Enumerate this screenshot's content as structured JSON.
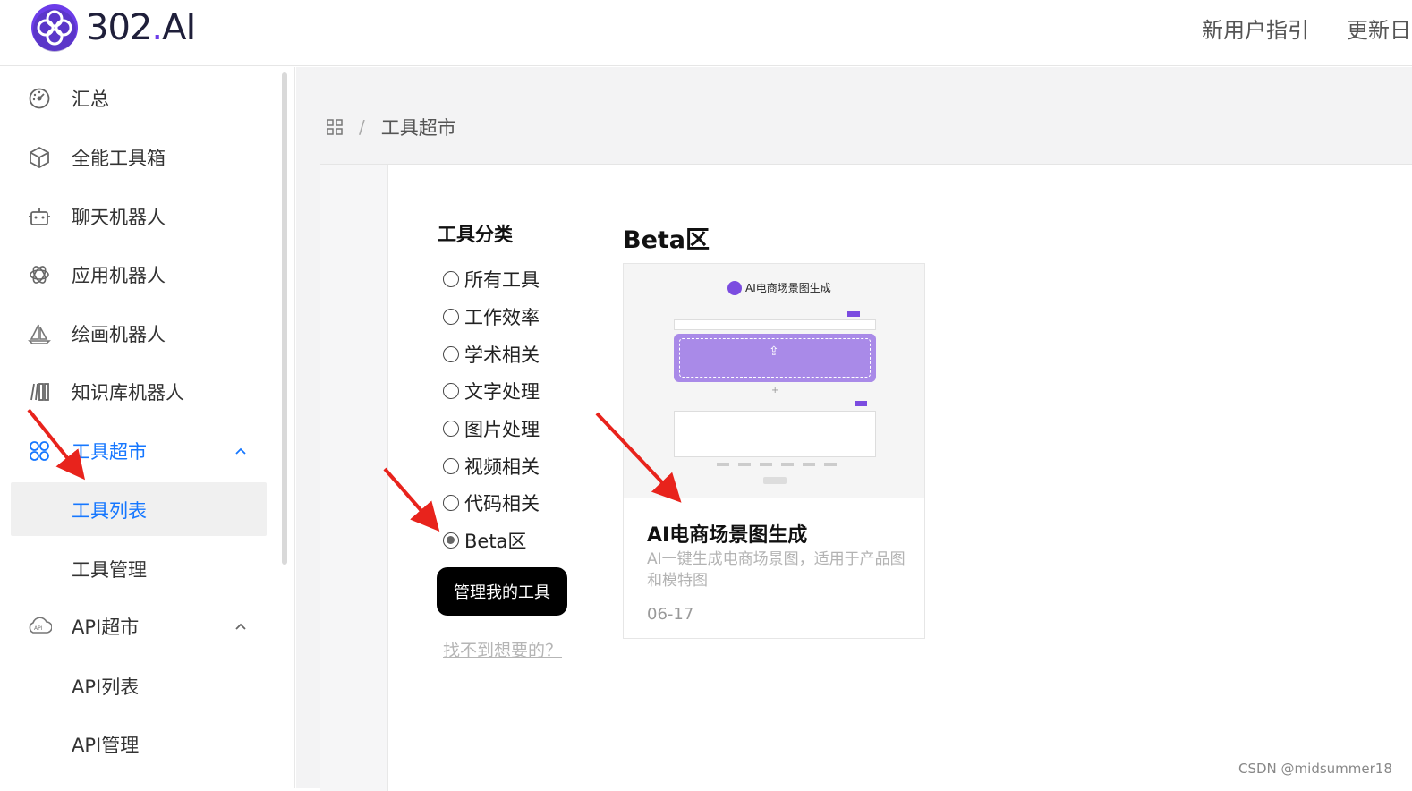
{
  "header": {
    "brand": "302",
    "brand_dot": ".",
    "brand_suffix": "AI",
    "nav": [
      "新用户指引",
      "更新日"
    ]
  },
  "sidebar": {
    "items": [
      {
        "label": "汇总",
        "icon": "dashboard-icon"
      },
      {
        "label": "全能工具箱",
        "icon": "cube-icon"
      },
      {
        "label": "聊天机器人",
        "icon": "robot-icon"
      },
      {
        "label": "应用机器人",
        "icon": "openai-icon"
      },
      {
        "label": "绘画机器人",
        "icon": "sailboat-icon"
      },
      {
        "label": "知识库机器人",
        "icon": "books-icon"
      },
      {
        "label": "工具超市",
        "icon": "grid-icon",
        "expanded": true
      },
      {
        "label": "API超市",
        "icon": "cloud-api-icon",
        "expanded": true
      }
    ],
    "tool_sub": [
      "工具列表",
      "工具管理"
    ],
    "api_sub": [
      "API列表",
      "API管理"
    ],
    "selected": "工具列表"
  },
  "breadcrumb": {
    "icon": "grid-icon",
    "separator": "/",
    "current": "工具超市"
  },
  "categories": {
    "title": "工具分类",
    "options": [
      "所有工具",
      "工作效率",
      "学术相关",
      "文字处理",
      "图片处理",
      "视频相关",
      "代码相关",
      "Beta区"
    ],
    "selected": "Beta区",
    "manage_button": "管理我的工具",
    "cant_find": "找不到想要的？"
  },
  "section": {
    "title": "Beta区"
  },
  "tool_card": {
    "preview_title": "AI电商场景图生成",
    "title": "AI电商场景图生成",
    "description": "AI一键生成电商场景图，适用于产品图和模特图",
    "date": "06-17"
  },
  "watermark": "CSDN @midsummer18",
  "colors": {
    "accent": "#1677ff",
    "brand_purple": "#6c3ce9",
    "annotation_red": "#e8231c"
  }
}
